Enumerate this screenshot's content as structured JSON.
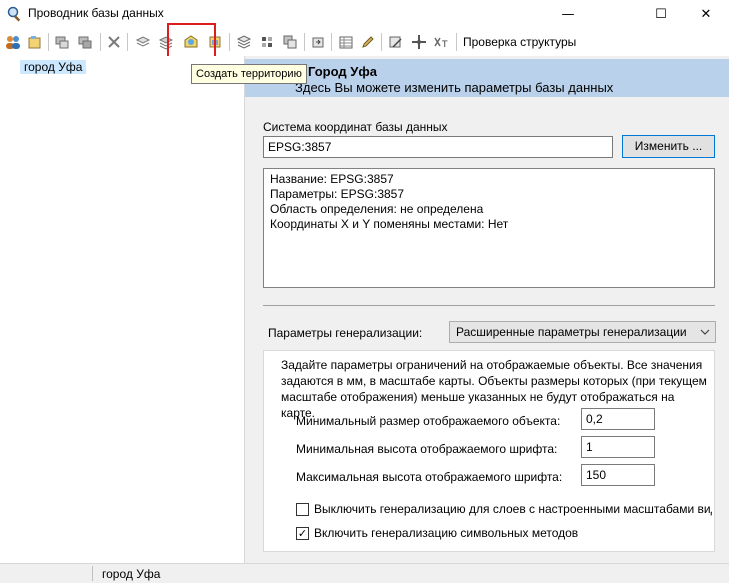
{
  "window": {
    "title": "Проводник базы данных",
    "minimize_glyph": "—",
    "maximize_glyph": "☐",
    "close_glyph": "✕"
  },
  "toolbar": {
    "structure_check_label": "Проверка структуры",
    "tooltip": "Создать территорию",
    "icons": [
      "users-icon",
      "database-add-icon",
      "layer-icon",
      "layer-edit-icon",
      "delete-icon",
      "copy-layers-icon",
      "paste-layers-icon",
      "create-territory-icon",
      "territory-settings-icon",
      "stack-icon",
      "grid-icon",
      "layers-overlay-icon",
      "export-icon",
      "table-icon",
      "pencil-icon",
      "grid-edit-icon",
      "move-icon",
      "text-style-icon"
    ]
  },
  "tree": {
    "selected_item": "город Уфа"
  },
  "header": {
    "title": "Город Уфа",
    "subtitle": "Здесь Вы можете изменить параметры базы данных"
  },
  "crs": {
    "label": "Система координат базы данных",
    "value": "EPSG:3857",
    "change_button": "Изменить ...",
    "info_lines": [
      "Название: EPSG:3857",
      "Параметры: EPSG:3857",
      "Область определения: не определена",
      "Координаты X и Y поменяны местами: Нет"
    ]
  },
  "generalization": {
    "label": "Параметры генерализации:",
    "selected_option": "Расширенные параметры генерализации",
    "description": "Задайте параметры ограничений на отображаемые объекты. Все значения задаются в мм, в масштабе карты. Объекты размеры которых (при текущем масштабе отображения) меньше указанных не будут отображаться на карте.",
    "min_object_label": "Минимальный размер отображаемого объекта:",
    "min_object_value": "0,2",
    "min_font_label": "Минимальная высота отображаемого шрифта:",
    "min_font_value": "1",
    "max_font_label": "Максимальная высота отображаемого шрифта:",
    "max_font_value": "150",
    "disable_checkbox_label": "Выключить генерализацию для слоев с настроенными масштабами вид",
    "disable_checked": false,
    "enable_symbol_label": "Включить генерализацию символьных методов",
    "enable_symbol_checked": true,
    "check_glyph": "✓"
  },
  "status": {
    "text": "город Уфа"
  },
  "colors": {
    "header_band": "#b9d1ea",
    "highlight": "#e01b1b",
    "tree_selection": "#cce8ff"
  }
}
